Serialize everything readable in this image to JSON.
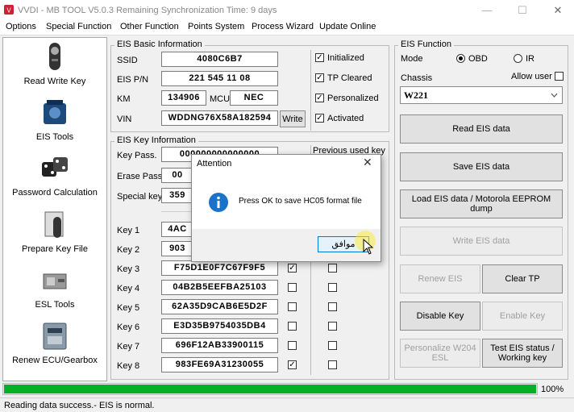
{
  "window": {
    "title": "VVDI - MB TOOL V5.0.3   Remaining Synchronization Time: 9 days",
    "minimize": "—",
    "maximize": "☐",
    "close": "✕"
  },
  "menu": [
    "Options",
    "Special Function",
    "Other Function",
    "Points System",
    "Process Wizard",
    "Update Online"
  ],
  "nav": [
    {
      "label": "Read Write Key",
      "icon": "car-key-icon"
    },
    {
      "label": "EIS Tools",
      "icon": "eis-module-icon"
    },
    {
      "label": "Password Calculation",
      "icon": "password-dice-icon"
    },
    {
      "label": "Prepare Key File",
      "icon": "key-file-icon"
    },
    {
      "label": "ESL Tools",
      "icon": "esl-lock-icon"
    },
    {
      "label": "Renew ECU/Gearbox",
      "icon": "ecu-board-icon"
    }
  ],
  "eis_basic": {
    "title": "EIS Basic Information",
    "ssid_label": "SSID",
    "ssid": "4080C6B7",
    "pn_label": "EIS P/N",
    "pn": "221 545 11 08",
    "km_label": "KM",
    "km": "134906",
    "mcu_label": "MCU",
    "mcu": "NEC",
    "vin_label": "VIN",
    "vin": "WDDNG76X58A182594",
    "write_btn": "Write",
    "checks": [
      {
        "label": "Initialized",
        "checked": true
      },
      {
        "label": "TP Cleared",
        "checked": true
      },
      {
        "label": "Personalized",
        "checked": true
      },
      {
        "label": "Activated",
        "checked": true
      }
    ]
  },
  "eis_key": {
    "title": "EIS Key Information",
    "keypass_label": "Key Pass.",
    "keypass": "000000000000000",
    "erasepass_label": "Erase Pass.",
    "erasepass": "00",
    "special_label": "Special key",
    "special": "359",
    "prev_used": "Previous used key",
    "keys": [
      {
        "label": "Key 1",
        "value": "4AC",
        "c1": false,
        "c2": false
      },
      {
        "label": "Key 2",
        "value": "903",
        "c1": false,
        "c2": false
      },
      {
        "label": "Key 3",
        "value": "F75D1E0F7C67F9F5",
        "c1": true,
        "c2": false
      },
      {
        "label": "Key 4",
        "value": "04B2B5EEFBA25103",
        "c1": false,
        "c2": false
      },
      {
        "label": "Key 5",
        "value": "62A35D9CAB6E5D2F",
        "c1": false,
        "c2": false
      },
      {
        "label": "Key 6",
        "value": "E3D35B9754035DB4",
        "c1": false,
        "c2": false
      },
      {
        "label": "Key 7",
        "value": "696F12AB33900115",
        "c1": false,
        "c2": false
      },
      {
        "label": "Key 8",
        "value": "983FE69A31230055",
        "c1": true,
        "c2": false
      }
    ]
  },
  "eis_function": {
    "title": "EIS Function",
    "mode_label": "Mode",
    "obd": "OBD",
    "ir": "IR",
    "mode_selected": "OBD",
    "chassis_label": "Chassis",
    "allow_user": "Allow user",
    "chassis_value": "W221",
    "read_btn": "Read EIS data",
    "save_btn": "Save EIS data",
    "load_btn": "Load EIS data / Motorola EEPROM dump",
    "write_btn": "Write EIS data",
    "renew_btn": "Renew EIS",
    "clear_tp_btn": "Clear TP",
    "disable_key_btn": "Disable Key",
    "enable_key_btn": "Enable Key",
    "personalize_btn": "Personalize W204 ESL",
    "test_btn": "Test EIS status / Working key"
  },
  "dialog": {
    "title": "Attention",
    "message": "Press OK to save HC05 format file",
    "ok": "موافق",
    "close": "✕"
  },
  "progress": {
    "value": 100,
    "label": "100%"
  },
  "status": "Reading data success.- EIS is normal.",
  "colors": {
    "progress": "#06b025",
    "info_icon": "#1a73c9"
  }
}
